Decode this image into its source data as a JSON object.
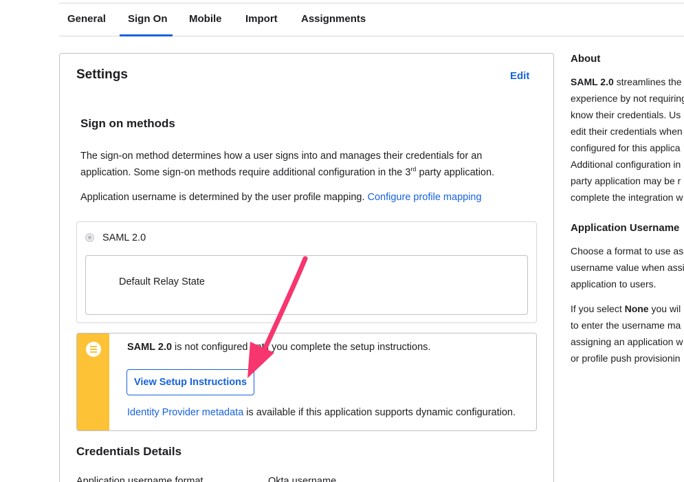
{
  "tabs": [
    {
      "label": "General"
    },
    {
      "label": "Sign On"
    },
    {
      "label": "Mobile"
    },
    {
      "label": "Import"
    },
    {
      "label": "Assignments"
    }
  ],
  "active_tab": "Sign On",
  "settings": {
    "title": "Settings",
    "edit_label": "Edit",
    "methods_title": "Sign on methods",
    "desc_part1": "The sign-on method determines how a user signs into and manages their credentials for an application. Some sign-on methods require additional configuration in the 3",
    "desc_sup": "rd",
    "desc_part2": " party application.",
    "username_text": "Application username is determined by the user profile mapping. ",
    "username_link": "Configure profile mapping",
    "saml_option": "SAML 2.0",
    "relay_label": "Default Relay State"
  },
  "notice": {
    "bold": "SAML 2.0",
    "text": " is not configured until you complete the setup instructions.",
    "button_label": "View Setup Instructions",
    "metadata_link": "Identity Provider metadata",
    "metadata_text": " is available if this application supports dynamic configuration."
  },
  "credentials": {
    "title": "Credentials Details",
    "col1": "Application username format",
    "col2": "Okta username"
  },
  "about": {
    "title": "About",
    "bold": "SAML 2.0",
    "lines": [
      " streamlines the",
      "experience by not requiring",
      "know their credentials. Us",
      "edit their credentials when",
      "configured for this applica",
      "Additional configuration in",
      "party application may be r",
      "complete the integration w"
    ],
    "app_username_title": "Application Username",
    "app_username_lines": [
      "Choose a format to use as",
      "username value when assi",
      "application to users."
    ],
    "none_prefix": "If you select ",
    "none_bold": "None",
    "none_suffix": " you wil",
    "none_lines": [
      "to enter the username ma",
      "assigning an application w",
      "or profile push provisionin"
    ]
  },
  "colors": {
    "link": "#1662dd",
    "warning": "#fdc236",
    "arrow": "#f7356f"
  }
}
